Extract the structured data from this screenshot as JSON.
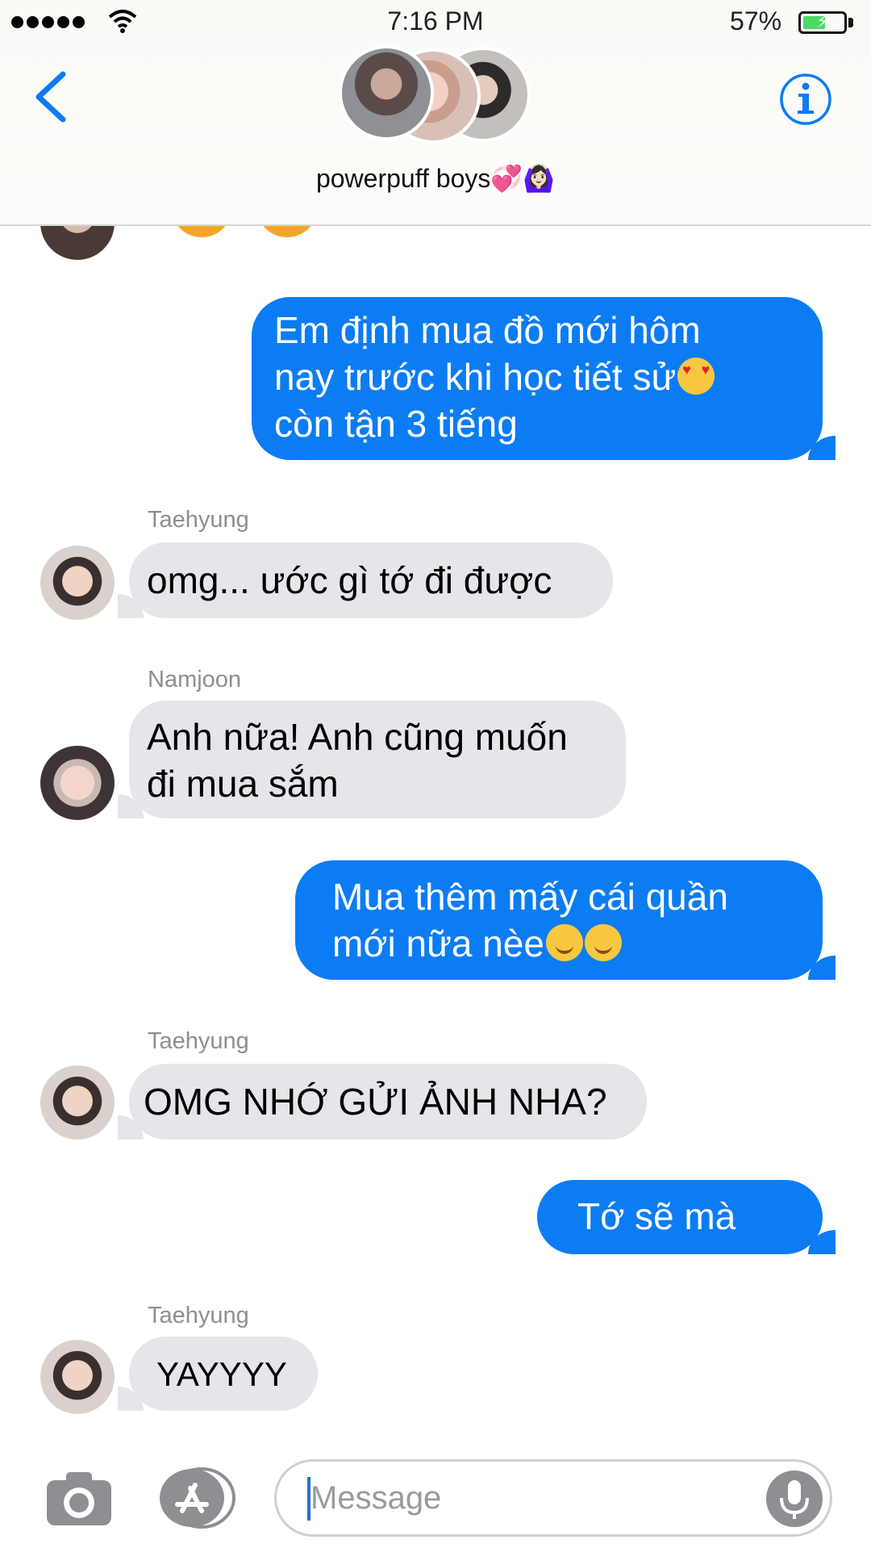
{
  "status_bar": {
    "time": "7:16 PM",
    "battery_percent": "57%",
    "battery_level": 0.57,
    "signal_bars": 5,
    "icons": [
      "signal-dots-icon",
      "wifi-icon",
      "battery-charging-icon"
    ]
  },
  "header": {
    "group_name": "powerpuff boys💞🙆🏻‍♀️",
    "icons": [
      "back-chevron-icon",
      "info-icon"
    ]
  },
  "colors": {
    "accent": "#0b7cf4",
    "incoming_bubble": "#e6e5ea",
    "sender_name": "#8e8e93"
  },
  "messages": [
    {
      "direction": "out",
      "lines": [
        "Em định mua đồ mới hôm",
        "nay trước khi học tiết sử",
        "còn tận 3 tiếng"
      ],
      "trailing_emoji": "heart-eyes"
    },
    {
      "direction": "in",
      "sender": "Taehyung",
      "lines": [
        "omg... ước gì tớ đi được"
      ]
    },
    {
      "direction": "in",
      "sender": "Namjoon",
      "lines": [
        "Anh nữa! Anh cũng muốn",
        "đi mua sắm"
      ]
    },
    {
      "direction": "out",
      "lines": [
        "Mua thêm mấy cái quần",
        "mới nữa nèe"
      ],
      "trailing_emoji": "smiling x2"
    },
    {
      "direction": "in",
      "sender": "Taehyung",
      "lines": [
        "OMG NHỚ GỬI ẢNH NHA?"
      ]
    },
    {
      "direction": "out",
      "lines": [
        "Tớ sẽ mà"
      ]
    },
    {
      "direction": "in",
      "sender": "Taehyung",
      "lines": [
        "YAYYYY"
      ]
    }
  ],
  "input_bar": {
    "placeholder": "Message",
    "value": "",
    "icons": [
      "camera-icon",
      "app-store-icon",
      "microphone-icon"
    ]
  }
}
